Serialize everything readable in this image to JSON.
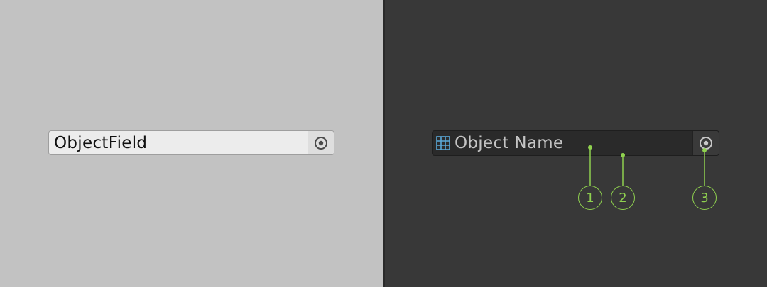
{
  "light_panel": {
    "object_field": {
      "label": "ObjectField",
      "picker_icon": "target-circle-icon"
    }
  },
  "dark_panel": {
    "object_field": {
      "type_icon": "grid-object-icon",
      "label": "Object Name",
      "picker_icon": "target-circle-icon"
    },
    "callouts": [
      "1",
      "2",
      "3"
    ]
  },
  "colors": {
    "light_bg": "#c2c2c2",
    "dark_bg": "#383838",
    "callout": "#8fd14f",
    "object_icon": "#5aa9d9"
  }
}
